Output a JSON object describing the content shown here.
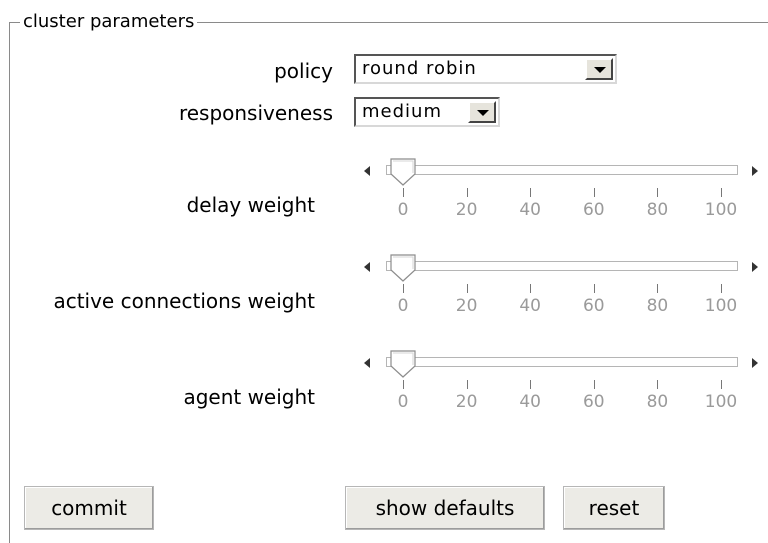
{
  "group": {
    "legend": "cluster parameters"
  },
  "fields": {
    "policy": {
      "label": "policy",
      "value": "round robin"
    },
    "responsiveness": {
      "label": "responsiveness",
      "value": "medium"
    }
  },
  "sliders": [
    {
      "label": "delay weight",
      "value": 0,
      "ticks": [
        "0",
        "20",
        "40",
        "60",
        "80",
        "100"
      ]
    },
    {
      "label": "active connections weight",
      "value": 0,
      "ticks": [
        "0",
        "20",
        "40",
        "60",
        "80",
        "100"
      ]
    },
    {
      "label": "agent weight",
      "value": 0,
      "ticks": [
        "0",
        "20",
        "40",
        "60",
        "80",
        "100"
      ]
    }
  ],
  "buttons": {
    "commit": "commit",
    "show_defaults": "show defaults",
    "reset": "reset"
  },
  "icons": {
    "dropdown": "chevron-down-icon",
    "slider_left": "arrow-left-icon",
    "slider_right": "arrow-right-icon"
  }
}
